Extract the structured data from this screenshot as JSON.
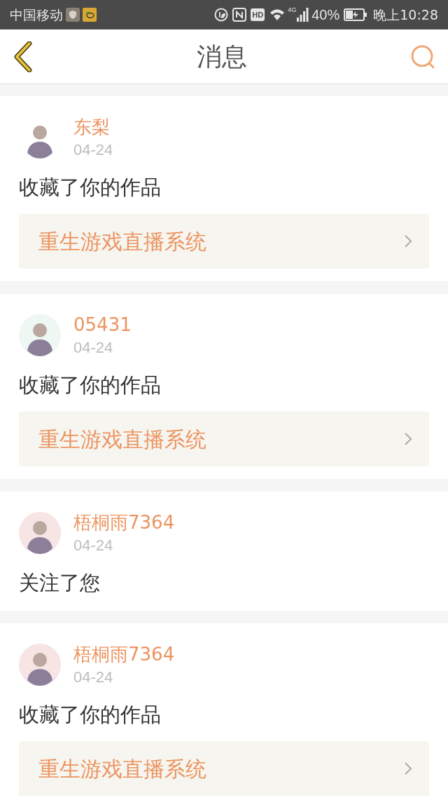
{
  "status_bar": {
    "carrier": "中国移动",
    "network": "4G",
    "hd": "HD",
    "battery": "40%",
    "time": "晚上10:28"
  },
  "header": {
    "title": "消息"
  },
  "messages": [
    {
      "user": "东梨",
      "date": "04-24",
      "action": "收藏了你的作品",
      "work": "重生游戏直播系统"
    },
    {
      "user": "05431",
      "date": "04-24",
      "action": "收藏了你的作品",
      "work": "重生游戏直播系统"
    },
    {
      "user": "梧桐雨7364",
      "date": "04-24",
      "action": "关注了您"
    },
    {
      "user": "梧桐雨7364",
      "date": "04-24",
      "action": "收藏了你的作品",
      "work": "重生游戏直播系统"
    }
  ]
}
